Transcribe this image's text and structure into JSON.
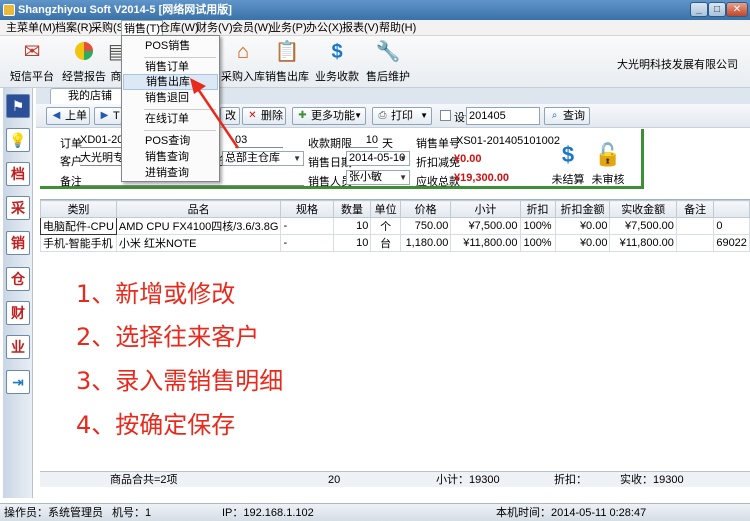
{
  "title": "Shangzhiyou Soft V2014-5 [网络网试用版]",
  "window_buttons": {
    "minimize": "_",
    "maximize": "□",
    "close": "✕"
  },
  "menu": [
    "主菜单(M)",
    "档案(R)",
    "采购(S)",
    "销售(T)",
    "仓库(W)",
    "财务(V)",
    "会员(W)",
    "业务(P)",
    "办公(X)",
    "报表(V)",
    "帮助(H)"
  ],
  "dropdown": [
    "POS销售",
    "销售订单",
    "销售出库",
    "销售退回",
    "在线订单",
    "POS查询",
    "销售查询",
    "进销查询"
  ],
  "toolbar": [
    {
      "label": "短信平台",
      "icon": "envelope-icon"
    },
    {
      "label": "经营报告",
      "icon": "pie-chart-icon"
    },
    {
      "label": "商",
      "icon": "store-icon"
    },
    {
      "label": "采购入库",
      "icon": "house-icon"
    },
    {
      "label": "销售出库",
      "icon": "clipboard-icon"
    },
    {
      "label": "业务收款",
      "icon": "dollar-icon"
    },
    {
      "label": "售后维护",
      "icon": "tools-icon"
    }
  ],
  "company": "大光明科技发展有限公司",
  "sidebar": [
    {
      "icon": "flag-icon",
      "glyph": "⚑"
    },
    {
      "icon": "lightbulb-icon",
      "glyph": "💡"
    },
    {
      "icon": "archive-icon",
      "glyph": "档"
    },
    {
      "icon": "purchase-icon",
      "glyph": "采"
    },
    {
      "icon": "sales-icon",
      "glyph": "销"
    },
    {
      "icon": "warehouse-icon",
      "glyph": "仓"
    },
    {
      "icon": "finance-icon",
      "glyph": "财"
    },
    {
      "icon": "business-icon",
      "glyph": "业"
    },
    {
      "icon": "exit-icon",
      "glyph": "⇥"
    }
  ],
  "tab": "我的店铺",
  "actions": {
    "prev": "上单",
    "next": "T",
    "edit": "改",
    "delete": "删除",
    "more": "更多功能",
    "print": "打印",
    "design": "设计",
    "search_value": "201405",
    "query": "查询"
  },
  "form": {
    "order_label": "订单",
    "order_value": "XD01-201",
    "order_tail": "03",
    "term_label": "收款期限",
    "term_value": "10",
    "term_unit": "天",
    "sales_no_label": "销售单号",
    "sales_no_value": "XS01-201405101002",
    "customer_label": "客户",
    "customer_value": "大光明专业",
    "warehouse_label": "仓",
    "warehouse_value": "总部主仓库",
    "date_label": "销售日期",
    "date_value": "2014-05-10",
    "discount_label": "折扣减免",
    "discount_value": "¥0.00",
    "remark_label": "备注",
    "salesman_label": "销售人员",
    "salesman_value": "张小敏",
    "receivable_label": "应收总款",
    "receivable_value": "¥19,300.00",
    "unsettled": "未结算",
    "unaudited": "未审核"
  },
  "table": {
    "headers": [
      "类别",
      "品名",
      "规格",
      "数量",
      "单位",
      "价格",
      "小计",
      "折扣",
      "折扣金额",
      "实收金额",
      "备注",
      ""
    ],
    "rows": [
      [
        "电脑配件-CPU",
        "AMD CPU FX4100四核/3.6/3.8G",
        "-",
        "10",
        "个",
        "750.00",
        "¥7,500.00",
        "100%",
        "¥0.00",
        "¥7,500.00",
        "",
        "0"
      ],
      [
        "手机-智能手机",
        "小米 红米NOTE",
        "-",
        "10",
        "台",
        "1,180.00",
        "¥11,800.00",
        "100%",
        "¥0.00",
        "¥11,800.00",
        "",
        "69022"
      ]
    ]
  },
  "annotations": [
    "1、新增或修改",
    "2、选择往来客户",
    "3、录入需销售明细",
    "4、按确定保存"
  ],
  "summary": {
    "items": "商品合共=2项",
    "qty": "20",
    "subtotal": "小计：19300",
    "discount": "折扣：",
    "paid": "实收：19300"
  },
  "status": {
    "operator": "操作员：系统管理员",
    "machine": "机号：1",
    "ip": "IP：192.168.1.102",
    "time": "本机时间：2014-05-11 0:28:47"
  },
  "colors": {
    "accent_green": "#3c8f32",
    "annotation_red": "#e8291c",
    "titlebar": "#3a71a8"
  }
}
